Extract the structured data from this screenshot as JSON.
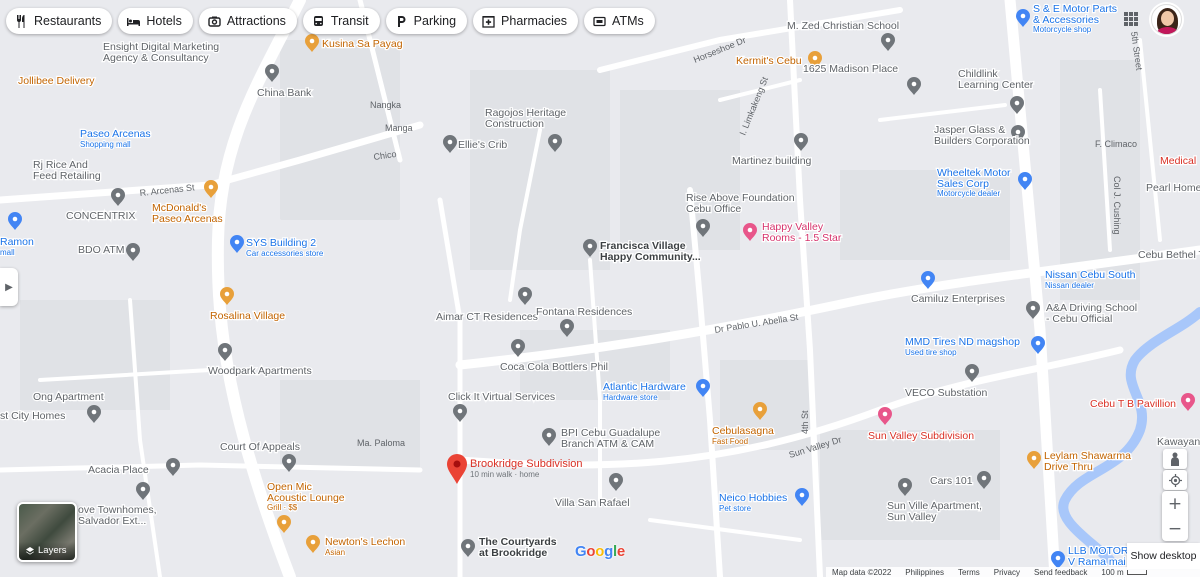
{
  "chips": [
    {
      "label": "Restaurants",
      "icon": "fork-knife-icon"
    },
    {
      "label": "Hotels",
      "icon": "bed-icon"
    },
    {
      "label": "Attractions",
      "icon": "camera-icon"
    },
    {
      "label": "Transit",
      "icon": "bus-icon"
    },
    {
      "label": "Parking",
      "icon": "parking-icon"
    },
    {
      "label": "Pharmacies",
      "icon": "pharmacy-icon"
    },
    {
      "label": "ATMs",
      "icon": "atm-icon"
    }
  ],
  "colors": {
    "map_bg": "#e8eaed",
    "road": "#ffffff",
    "water": "#9fc1f5",
    "poi_gray": "#70757a",
    "poi_blue": "#4285f4",
    "poi_orange": "#e8a03a",
    "poi_pink": "#e8568a",
    "text_gray": "#5f6368",
    "text_blue": "#1a73e8",
    "text_orange": "#c26401",
    "text_pink": "#d6336c",
    "text_red": "#d93025",
    "selected_pin": "#ea4335"
  },
  "streets": [
    {
      "name": "Horseshoe Dr"
    },
    {
      "name": "Nangka"
    },
    {
      "name": "Manga"
    },
    {
      "name": "Chico"
    },
    {
      "name": "R. Arcenas St"
    },
    {
      "name": "I. Limkakeng St"
    },
    {
      "name": "Dr Pablo U. Abella St"
    },
    {
      "name": "Ma. Paloma"
    },
    {
      "name": "4th St"
    },
    {
      "name": "Sun Valley Dr"
    },
    {
      "name": "F. Climaco"
    },
    {
      "name": "Col J. Cushing"
    },
    {
      "name": "5th Street"
    }
  ],
  "places": [
    {
      "name": "Ensight Digital Marketing",
      "name2": "Agency & Consultancy",
      "color": "gray",
      "icon": null
    },
    {
      "name": "Kusina Sa Payag",
      "color": "orange",
      "icon": "restaurant-icon"
    },
    {
      "name": "Jollibee Delivery",
      "color": "orange",
      "icon": null
    },
    {
      "name": "China Bank",
      "color": "gray",
      "icon": "bank-icon"
    },
    {
      "name": "Paseo Arcenas",
      "sub": "Shopping mall",
      "color": "blue",
      "icon": "shopping-icon"
    },
    {
      "name": "Rj Rice And",
      "name2": "Feed Retailing",
      "color": "gray",
      "icon": "place-icon"
    },
    {
      "name": "CONCENTRIX",
      "color": "gray",
      "icon": null
    },
    {
      "name": "McDonald's",
      "name2": "Paseo Arcenas",
      "color": "orange",
      "icon": "restaurant-icon"
    },
    {
      "name": "Ramon",
      "sub": "mall",
      "color": "blue",
      "icon": "shopping-icon"
    },
    {
      "name": "BDO ATM",
      "color": "gray",
      "icon": "atm-icon"
    },
    {
      "name": "SYS Building 2",
      "sub": "Car accessories store",
      "color": "blue",
      "icon": "shopping-icon"
    },
    {
      "name": "Rosalina Village",
      "color": "orange",
      "icon": "restaurant-icon"
    },
    {
      "name": "Woodpark Apartments",
      "color": "gray",
      "icon": "place-icon"
    },
    {
      "name": "Ong Apartment",
      "color": "gray",
      "icon": null
    },
    {
      "name": "st City Homes",
      "color": "gray",
      "icon": "place-icon"
    },
    {
      "name": "Court Of Appeals",
      "color": "gray",
      "icon": "government-icon"
    },
    {
      "name": "Acacia Place",
      "color": "gray",
      "icon": "place-icon"
    },
    {
      "name": "ove Townhomes,",
      "name2": "Salvador Ext...",
      "color": "gray",
      "icon": "place-icon"
    },
    {
      "name": "Open Mic",
      "name2": "Acoustic Lounge",
      "sub": "Grill · $$",
      "color": "orange",
      "icon": "restaurant-icon"
    },
    {
      "name": "Newton's Lechon",
      "sub": "Asian",
      "color": "orange",
      "icon": "restaurant-icon"
    },
    {
      "name": "Ragojos Heritage",
      "name2": "Construction",
      "color": "gray",
      "icon": "place-icon"
    },
    {
      "name": "Ellie's Crib",
      "color": "gray",
      "icon": "place-icon"
    },
    {
      "name": "Francisca Village",
      "name2": "Happy Community...",
      "color": "dark",
      "icon": "place-icon"
    },
    {
      "name": "Aimar CT Residences",
      "color": "gray",
      "icon": "place-icon"
    },
    {
      "name": "Fontana Residences",
      "color": "gray",
      "icon": "place-icon"
    },
    {
      "name": "Coca Cola Bottlers Phil",
      "color": "gray",
      "icon": "place-icon"
    },
    {
      "name": "Click It Virtual Services",
      "color": "gray",
      "icon": "place-icon"
    },
    {
      "name": "BPI Cebu Guadalupe",
      "name2": "Branch ATM & CAM",
      "color": "gray",
      "icon": "bank-icon"
    },
    {
      "name": "Villa San Rafael",
      "color": "gray",
      "icon": "place-icon"
    },
    {
      "name": "The Courtyards",
      "name2": "at Brookridge",
      "color": "dark",
      "icon": "place-icon"
    },
    {
      "name": "M. Zed Christian School",
      "color": "gray",
      "icon": "place-icon"
    },
    {
      "name": "Kermit's Cebu",
      "color": "orange",
      "icon": "restaurant-icon"
    },
    {
      "name": "1625 Madison Place",
      "color": "gray",
      "icon": "place-icon"
    },
    {
      "name": "Martinez building",
      "color": "gray",
      "icon": "place-icon"
    },
    {
      "name": "Rise Above Foundation",
      "name2": "Cebu Office",
      "color": "gray",
      "icon": "place-icon"
    },
    {
      "name": "Happy Valley",
      "name2": "Rooms - 1.5 Star",
      "color": "pink",
      "icon": "hotel-icon"
    },
    {
      "name": "Atlantic Hardware",
      "sub": "Hardware store",
      "color": "blue",
      "icon": "shopping-icon"
    },
    {
      "name": "Cebulasagna",
      "sub": "Fast Food",
      "color": "orange",
      "icon": "restaurant-icon"
    },
    {
      "name": "Neico Hobbies",
      "sub": "Pet store",
      "color": "blue",
      "icon": "shopping-icon"
    },
    {
      "name": "S & E Motor Parts",
      "name2": "& Accessories",
      "sub": "Motorcycle shop",
      "color": "blue",
      "icon": "shopping-icon"
    },
    {
      "name": "Childlink",
      "name2": "Learning Center",
      "color": "gray",
      "icon": "place-icon"
    },
    {
      "name": "Jasper Glass &",
      "name2": "Builders Corporation",
      "color": "gray",
      "icon": "place-icon"
    },
    {
      "name": "Wheeltek Motor",
      "name2": "Sales Corp",
      "sub": "Motorcycle dealer",
      "color": "blue",
      "icon": "shopping-icon"
    },
    {
      "name": "Medical",
      "color": "red",
      "icon": null
    },
    {
      "name": "Pearl Home",
      "color": "gray",
      "icon": null
    },
    {
      "name": "Cebu Bethel Temp",
      "color": "gray",
      "icon": null
    },
    {
      "name": "Nissan Cebu South",
      "sub": "Nissan dealer",
      "color": "blue",
      "icon": "shopping-icon"
    },
    {
      "name": "Camiluz Enterprises",
      "color": "gray",
      "icon": "place-icon"
    },
    {
      "name": "A&A Driving School",
      "name2": "- Cebu Official",
      "color": "gray",
      "icon": "place-icon"
    },
    {
      "name": "MMD Tires ND magshop",
      "sub": "Used tire shop",
      "color": "blue",
      "icon": "shopping-icon"
    },
    {
      "name": "VECO Substation",
      "color": "gray",
      "icon": "place-icon"
    },
    {
      "name": "Cebu T B Pavillion",
      "color": "red",
      "icon": "hospital-icon"
    },
    {
      "name": "Sun Valley Subdivision",
      "color": "red",
      "icon": "hotel-icon"
    },
    {
      "name": "Leylam Shawarma",
      "name2": "Drive Thru",
      "color": "orange",
      "icon": "restaurant-icon"
    },
    {
      "name": "Cars 101",
      "color": "gray",
      "icon": "place-icon"
    },
    {
      "name": "Sun Ville Apartment,",
      "name2": "Sun Valley",
      "color": "gray",
      "icon": "place-icon"
    },
    {
      "name": "Kawayan",
      "color": "gray",
      "icon": null
    },
    {
      "name": "LLB MOTOR",
      "name2": "V Rama mai",
      "color": "blue",
      "icon": "shopping-icon"
    }
  ],
  "selected": {
    "name": "Brookridge Subdivision",
    "sub": "10 min walk · home"
  },
  "layers_label": "Layers",
  "google_logo": "Google",
  "show_desktop": "Show desktop",
  "footer": {
    "map_data": "Map data ©2022",
    "country": "Philippines",
    "terms": "Terms",
    "privacy": "Privacy",
    "feedback": "Send feedback",
    "scale": "100 m"
  }
}
